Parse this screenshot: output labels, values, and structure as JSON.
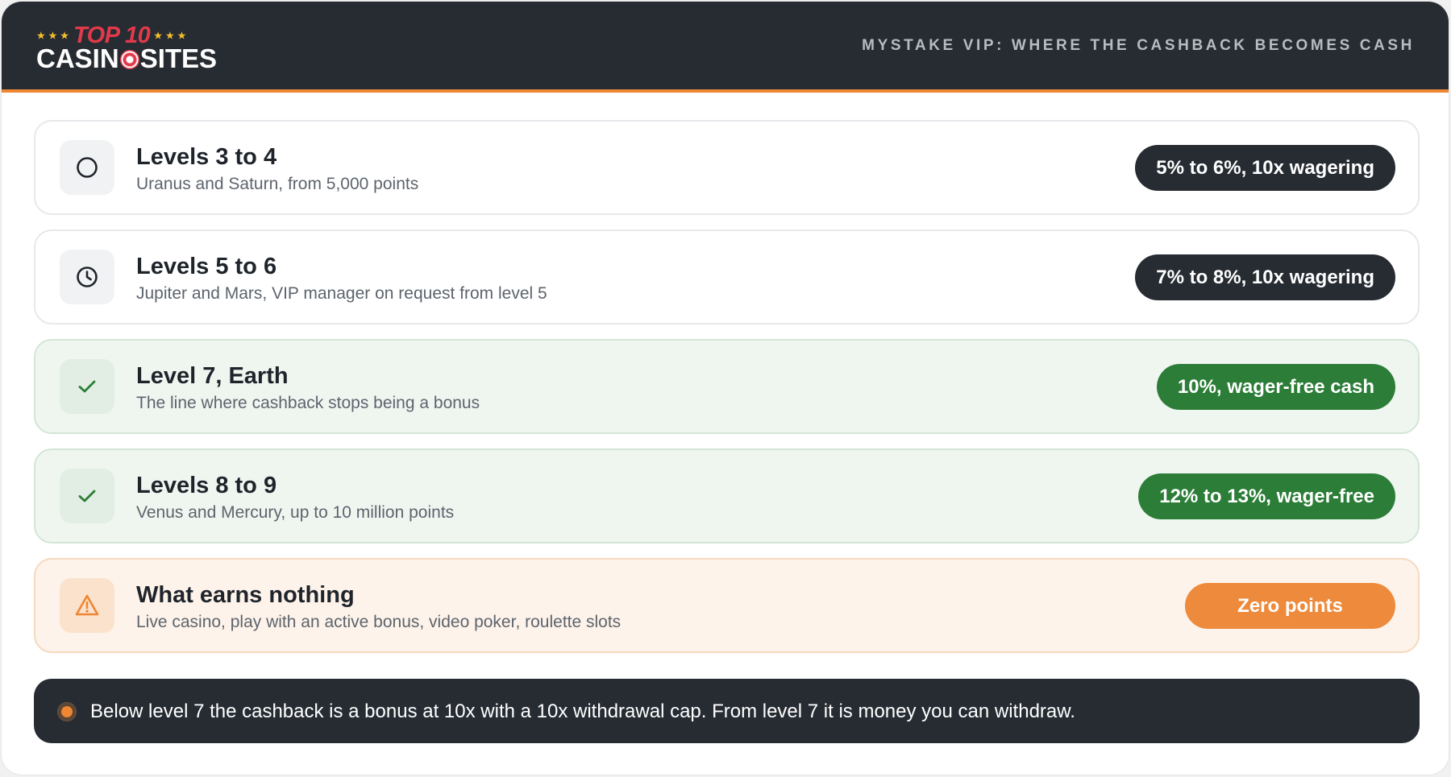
{
  "header": {
    "logo_top": "TOP 10",
    "logo_bottom_left": "CASIN",
    "logo_bottom_right": "SITES",
    "logo_stars": "★★★",
    "title": "MYSTAKE VIP: WHERE THE CASHBACK BECOMES CASH"
  },
  "colors": {
    "header_bg": "#272c33",
    "accent_orange": "#ee8632",
    "green": "#2b7d37",
    "logo_red": "#e23a4a",
    "star_yellow": "#f3c02d"
  },
  "rows": [
    {
      "icon": "circle-icon",
      "title": "Levels 3 to 4",
      "subtitle": "Uranus and Saturn, from 5,000 points",
      "badge": "5% to 6%, 10x wagering"
    },
    {
      "icon": "clock-icon",
      "title": "Levels 5 to 6",
      "subtitle": "Jupiter and Mars, VIP manager on request from level 5",
      "badge": "7% to 8%, 10x wagering"
    },
    {
      "icon": "check-icon",
      "title": "Level 7, Earth",
      "subtitle": "The line where cashback stops being a bonus",
      "badge": "10%, wager-free cash"
    },
    {
      "icon": "check-icon",
      "title": "Levels 8 to 9",
      "subtitle": "Venus and Mercury, up to 10 million points",
      "badge": "12% to 13%, wager-free"
    },
    {
      "icon": "warning-icon",
      "title": "What earns nothing",
      "subtitle": "Live casino, play with an active bonus, video poker, roulette slots",
      "badge": "Zero points"
    }
  ],
  "note": {
    "text": "Below level 7 the cashback is a bonus at 10x with a 10x withdrawal cap. From level 7 it is money you can withdraw."
  }
}
